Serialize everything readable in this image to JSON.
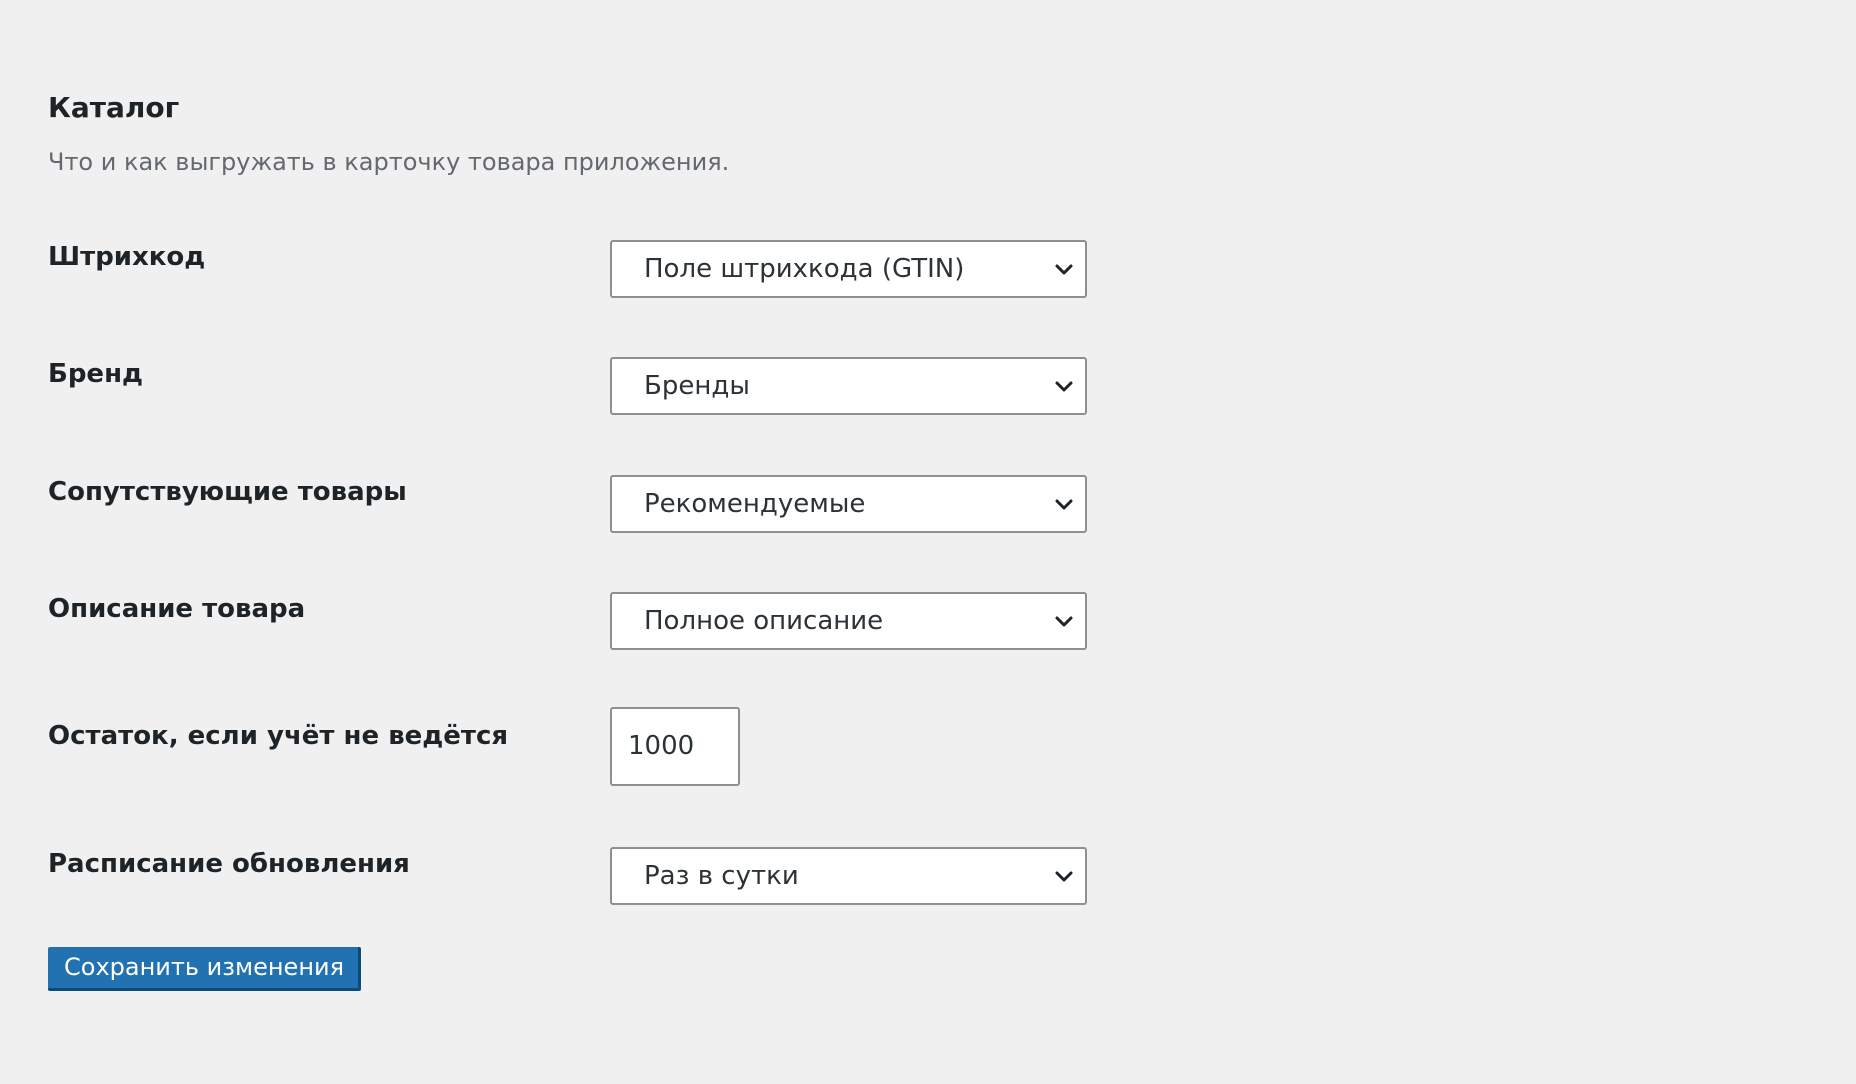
{
  "section": {
    "title": "Каталог",
    "description": "Что и как выгружать в карточку товара приложения."
  },
  "fields": {
    "barcode": {
      "label": "Штрихкод",
      "value": "Поле штрихкода (GTIN)"
    },
    "brand": {
      "label": "Бренд",
      "value": "Бренды"
    },
    "related": {
      "label": "Сопутствующие товары",
      "value": "Рекомендуемые"
    },
    "description": {
      "label": "Описание товара",
      "value": "Полное описание"
    },
    "stock": {
      "label": "Остаток, если учёт не ведётся",
      "value": "1000"
    },
    "schedule": {
      "label": "Расписание обновления",
      "value": "Раз в сутки"
    }
  },
  "actions": {
    "save_label": "Сохранить изменения"
  },
  "icons": {
    "dropdown": "chevron-down-icon"
  },
  "colors": {
    "background": "#f0f0f1",
    "primary_button": "#2271b1",
    "input_border": "#8c8f94",
    "muted_text": "#646970"
  }
}
